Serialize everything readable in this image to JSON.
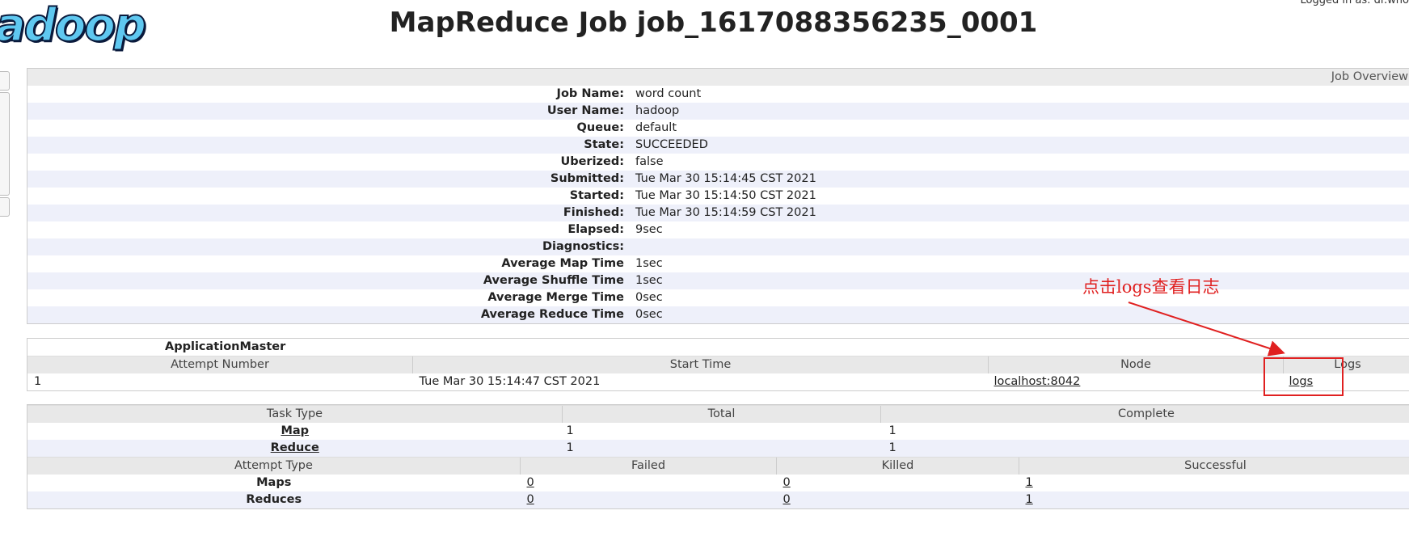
{
  "header": {
    "logo_text": "adoop",
    "title": "MapReduce Job job_1617088356235_0001",
    "logged_in": "Logged in as: dr.who"
  },
  "job_overview": {
    "section_title": "Job Overview",
    "rows": [
      {
        "label": "Job Name:",
        "value": "word count"
      },
      {
        "label": "User Name:",
        "value": "hadoop"
      },
      {
        "label": "Queue:",
        "value": "default"
      },
      {
        "label": "State:",
        "value": "SUCCEEDED"
      },
      {
        "label": "Uberized:",
        "value": "false"
      },
      {
        "label": "Submitted:",
        "value": "Tue Mar 30 15:14:45 CST 2021"
      },
      {
        "label": "Started:",
        "value": "Tue Mar 30 15:14:50 CST 2021"
      },
      {
        "label": "Finished:",
        "value": "Tue Mar 30 15:14:59 CST 2021"
      },
      {
        "label": "Elapsed:",
        "value": "9sec"
      },
      {
        "label": "Diagnostics:",
        "value": ""
      },
      {
        "label": "Average Map Time",
        "value": "1sec"
      },
      {
        "label": "Average Shuffle Time",
        "value": "1sec"
      },
      {
        "label": "Average Merge Time",
        "value": "0sec"
      },
      {
        "label": "Average Reduce Time",
        "value": "0sec"
      }
    ]
  },
  "application_master": {
    "title": "ApplicationMaster",
    "columns": [
      "Attempt Number",
      "Start Time",
      "Node",
      "Logs"
    ],
    "row": {
      "attempt": "1",
      "start_time": "Tue Mar 30 15:14:47 CST 2021",
      "node": "localhost:8042",
      "logs": "logs"
    }
  },
  "tasks": {
    "columns": [
      "Task Type",
      "Total",
      "Complete"
    ],
    "rows": [
      {
        "type": "Map",
        "total": "1",
        "complete": "1"
      },
      {
        "type": "Reduce",
        "total": "1",
        "complete": "1"
      }
    ]
  },
  "attempts": {
    "columns": [
      "Attempt Type",
      "Failed",
      "Killed",
      "Successful"
    ],
    "rows": [
      {
        "type": "Maps",
        "failed": "0",
        "killed": "0",
        "successful": "1"
      },
      {
        "type": "Reduces",
        "failed": "0",
        "killed": "0",
        "successful": "1"
      }
    ]
  },
  "annotation": {
    "text": "点击logs查看日志",
    "color": "#e02020"
  }
}
